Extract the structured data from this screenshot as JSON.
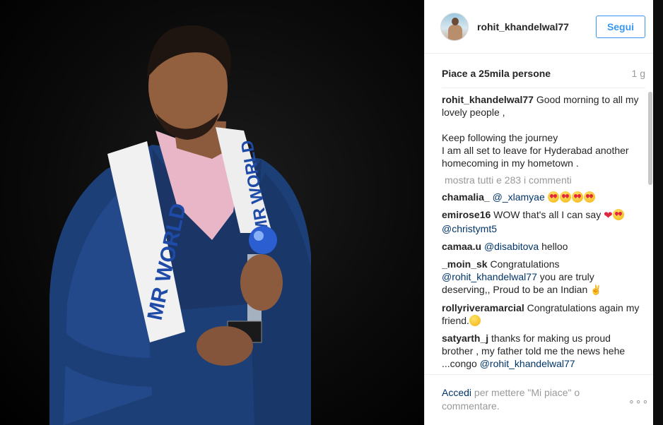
{
  "post": {
    "username": "rohit_khandelwal77",
    "follow_label": "Segui",
    "likes_text": "Piace a 25mila persone",
    "time_ago": "1 g",
    "caption_user": "rohit_khandelwal77",
    "caption_line1": " Good morning to all my lovely people ,",
    "caption_line2": "Keep following the journey",
    "caption_line3": "I am all set to leave for Hyderabad another homecoming in my hometown .",
    "show_all_comments": "mostra tutti e 283 i commenti"
  },
  "photo": {
    "sash_text_left": "MR WORLD",
    "sash_text_right": "MR WORLD"
  },
  "comments": [
    {
      "user": "chamalia_",
      "mention": "@_xlamyae",
      "text": "",
      "emoji": "heart-eyes x4"
    },
    {
      "user": "emirose16",
      "text": " WOW that's all I can say ",
      "mention": "@christymt5",
      "emoji": "heart, heart-eyes"
    },
    {
      "user": "camaa.u",
      "mention": "@disabitova",
      "text": " helloo"
    },
    {
      "user": "_moin_sk",
      "text": " Congratulations",
      "mention": "@rohit_khandelwal77",
      "text2": " you are truly deserving,, Proud to be an Indian "
    },
    {
      "user": "rollyriveramarcial",
      "text": " Congratulations again my friend.",
      "emoji": "smile"
    },
    {
      "user": "satyarth_j",
      "text": " thanks for making us proud brother , my father told me the news hehe ...congo ",
      "mention": "@rohit_khandelwal77"
    }
  ],
  "footer": {
    "login_link": "Accedi",
    "login_prompt": " per mettere \"Mi piace\" o commentare.",
    "more_options": "∘∘∘"
  },
  "colors": {
    "accent": "#3897f0",
    "link": "#003569",
    "muted": "#999999"
  }
}
